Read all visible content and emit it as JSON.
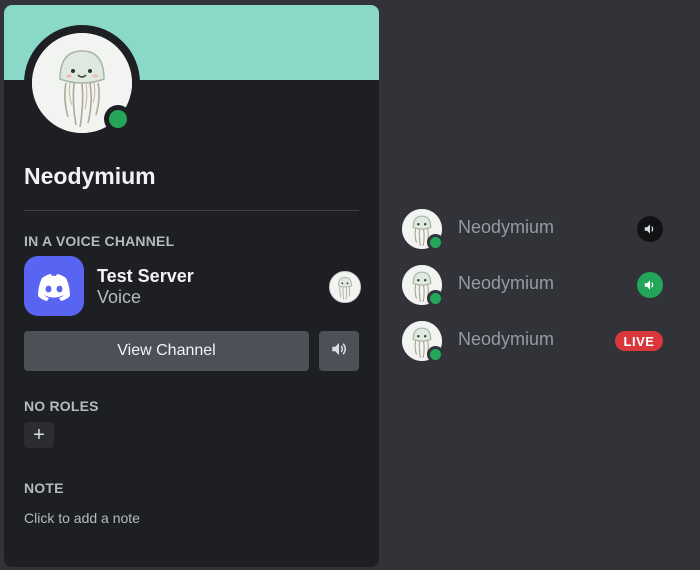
{
  "profile": {
    "username": "Neodymium",
    "avatar_icon": "jellyfish-avatar",
    "status_color": "#23a55a",
    "banner_color": "#8ad9c8"
  },
  "voice": {
    "section_title": "IN A VOICE CHANNEL",
    "server_name": "Test Server",
    "channel_name": "Voice",
    "view_button_label": "View Channel",
    "volume_icon": "speaker-icon"
  },
  "roles": {
    "section_title": "NO ROLES",
    "add_label": "+"
  },
  "note": {
    "section_title": "NOTE",
    "placeholder": "Click to add a note"
  },
  "voice_list": [
    {
      "name": "Neodymium",
      "indicator": "speaker-muted-dark"
    },
    {
      "name": "Neodymium",
      "indicator": "speaker-speaking-green"
    },
    {
      "name": "Neodymium",
      "indicator": "live-badge",
      "badge": "LIVE"
    }
  ]
}
